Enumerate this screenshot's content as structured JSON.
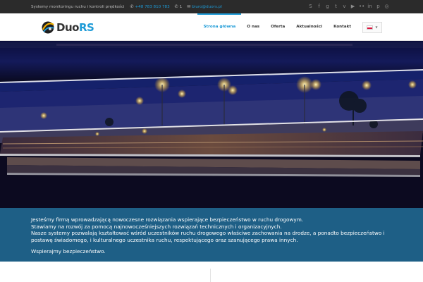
{
  "topbar": {
    "tagline": "Systemy monitoringu ruchu i kontroli prędkości",
    "phone": "+48 783 810 783",
    "extension": "1",
    "email": "biuro@duors.pl",
    "social_icons": [
      "skype-icon",
      "facebook-icon",
      "google-plus-icon",
      "twitter-icon",
      "vimeo-icon",
      "youtube-icon",
      "flickr-icon",
      "linkedin-icon",
      "pinterest-icon",
      "dribbble-icon"
    ]
  },
  "header": {
    "logo_text_a": "Duo",
    "logo_text_b": "RS",
    "nav": [
      "Strona główna",
      "O nas",
      "Oferta",
      "Aktualności",
      "Kontakt"
    ],
    "active_nav": "Strona główna",
    "language_flag": "pl-flag"
  },
  "band": {
    "line1": "Jesteśmy firmą wprowadzającą nowoczesne rozwiązania wspierające bezpieczeństwo w ruchu drogowym.",
    "line2": "Stawiamy na rozwój za pomocą najnowocześniejszych rozwiązań technicznych i organizacyjnych.",
    "line3": "Nasze systemy pozwalają kształtować wśród uczestników ruchu drogowego właściwe zachowania na drodze, a ponadto bezpieczeństwo i postawę świadomego, i kulturalnego uczestnika ruchu, respektującego oraz szanującego prawa innych.",
    "line4": "Wspierajmy bezpieczeństwo."
  },
  "colors": {
    "accent": "#1e9bd7",
    "topbar_bg": "#2b2b2b",
    "band_bg": "#1e5f86",
    "hero_bg": "#0c0a20"
  }
}
